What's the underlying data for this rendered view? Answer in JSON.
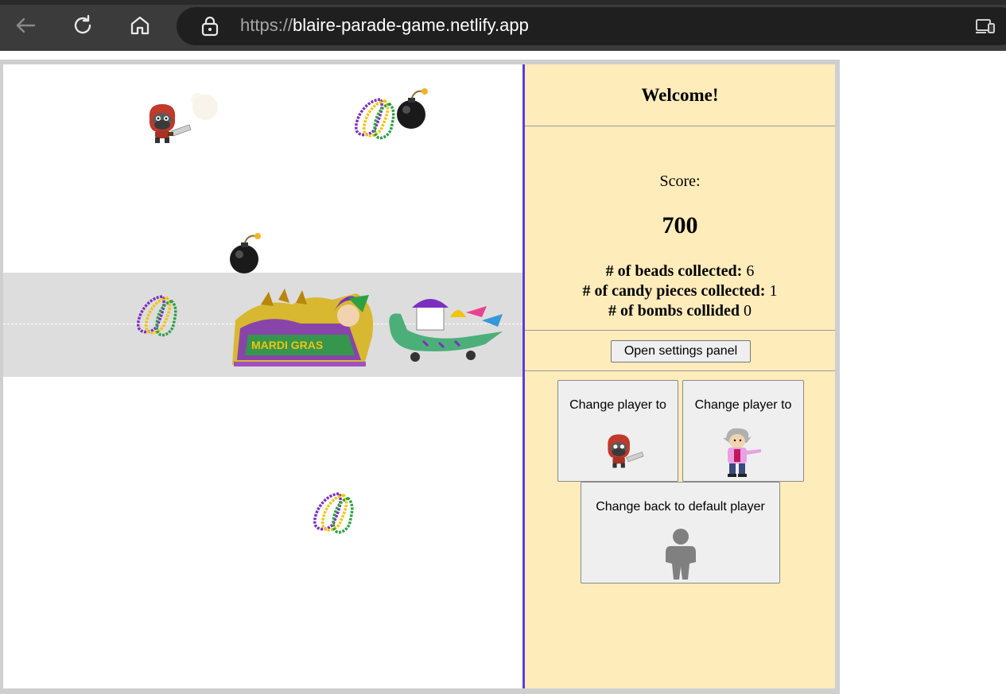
{
  "browser": {
    "url_scheme": "https://",
    "url_host": "blaire-parade-game.netlify.app"
  },
  "panel": {
    "welcome": "Welcome!",
    "score_label": "Score:",
    "score_value": "700",
    "stats": {
      "beads_label": "# of beads collected:",
      "beads_value": "6",
      "candy_label": "# of candy pieces collected:",
      "candy_value": "1",
      "bombs_label": "# of bombs collided",
      "bombs_value": "0"
    },
    "settings_button": "Open settings panel",
    "change_player_1": "Change player to",
    "change_player_2": "Change player to",
    "change_default": "Change back to default player"
  },
  "float_logo_text": "MARDI GRAS",
  "colors": {
    "panel_bg": "#ffecbb",
    "divider": "#5b40d6",
    "street": "#dddddd",
    "bead_purple": "#7b2fbf",
    "bead_gold": "#f1c40f",
    "bead_green": "#2ea043"
  }
}
